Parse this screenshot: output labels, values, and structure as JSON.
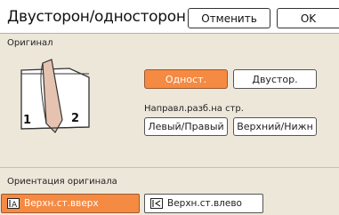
{
  "header": {
    "title": "Двусторон/односторон",
    "cancel_label": "Отменить",
    "ok_label": "OK"
  },
  "original": {
    "section_label": "Оригинал",
    "page_numbers": [
      "1",
      "2"
    ],
    "buttons": [
      {
        "label": "Одност.",
        "selected": true
      },
      {
        "label": "Двустор.",
        "selected": false
      }
    ]
  },
  "direction": {
    "label": "Направл.разб.на стр.",
    "buttons": [
      {
        "label": "Левый/Правый"
      },
      {
        "label": "Верхний/Нижн"
      }
    ]
  },
  "orientation": {
    "label": "Ориентация оригинала",
    "buttons": [
      {
        "label": "Верхн.ст.вверх",
        "icon": "top-up-icon",
        "selected": true
      },
      {
        "label": "Верхн.ст.влево",
        "icon": "top-left-icon",
        "selected": false
      }
    ]
  },
  "colors": {
    "accent": "#f58a43",
    "panel_bg": "#ede7da",
    "page_illustration": "#e6c3b0"
  }
}
